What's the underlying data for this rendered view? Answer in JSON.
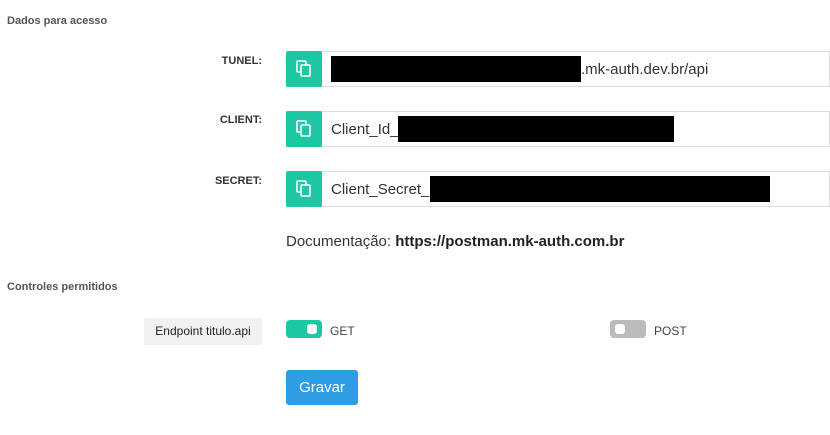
{
  "access_section": {
    "title": "Dados para acesso",
    "fields": [
      {
        "label": "TUNEL:",
        "value": ".mk-auth.dev.br/api"
      },
      {
        "label": "CLIENT:",
        "value": "Client_Id_"
      },
      {
        "label": "SECRET:",
        "value": "Client_Secret_"
      }
    ],
    "documentation": {
      "label": "Documentação:",
      "link": "https://postman.mk-auth.com.br"
    }
  },
  "controls_section": {
    "title": "Controles permitidos",
    "endpoint_label": "Endpoint titulo.api",
    "toggles": [
      {
        "label": "GET",
        "enabled": true
      },
      {
        "label": "POST",
        "enabled": false
      }
    ]
  },
  "submit_label": "Gravar",
  "colors": {
    "accent": "#1cc7a3",
    "button": "#2f9de4",
    "toggle_off": "#bbbbbb"
  }
}
